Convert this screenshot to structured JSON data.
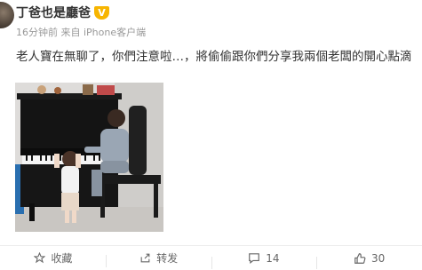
{
  "post": {
    "username": "丁爸也是廳爸",
    "verified_badge": "V",
    "meta": "16分钟前 来自 iPhone客户端",
    "text": "老人寶在無聊了，你們注意啦…，將偷偷跟你們分享我兩個老闆的開心點滴"
  },
  "actions": {
    "favorite_label": "收藏",
    "repost_label": "转发",
    "comment_count": "14",
    "like_count": "30"
  },
  "colors": {
    "badge": "#f7b500",
    "meta_text": "#999999",
    "action_text": "#666666"
  }
}
